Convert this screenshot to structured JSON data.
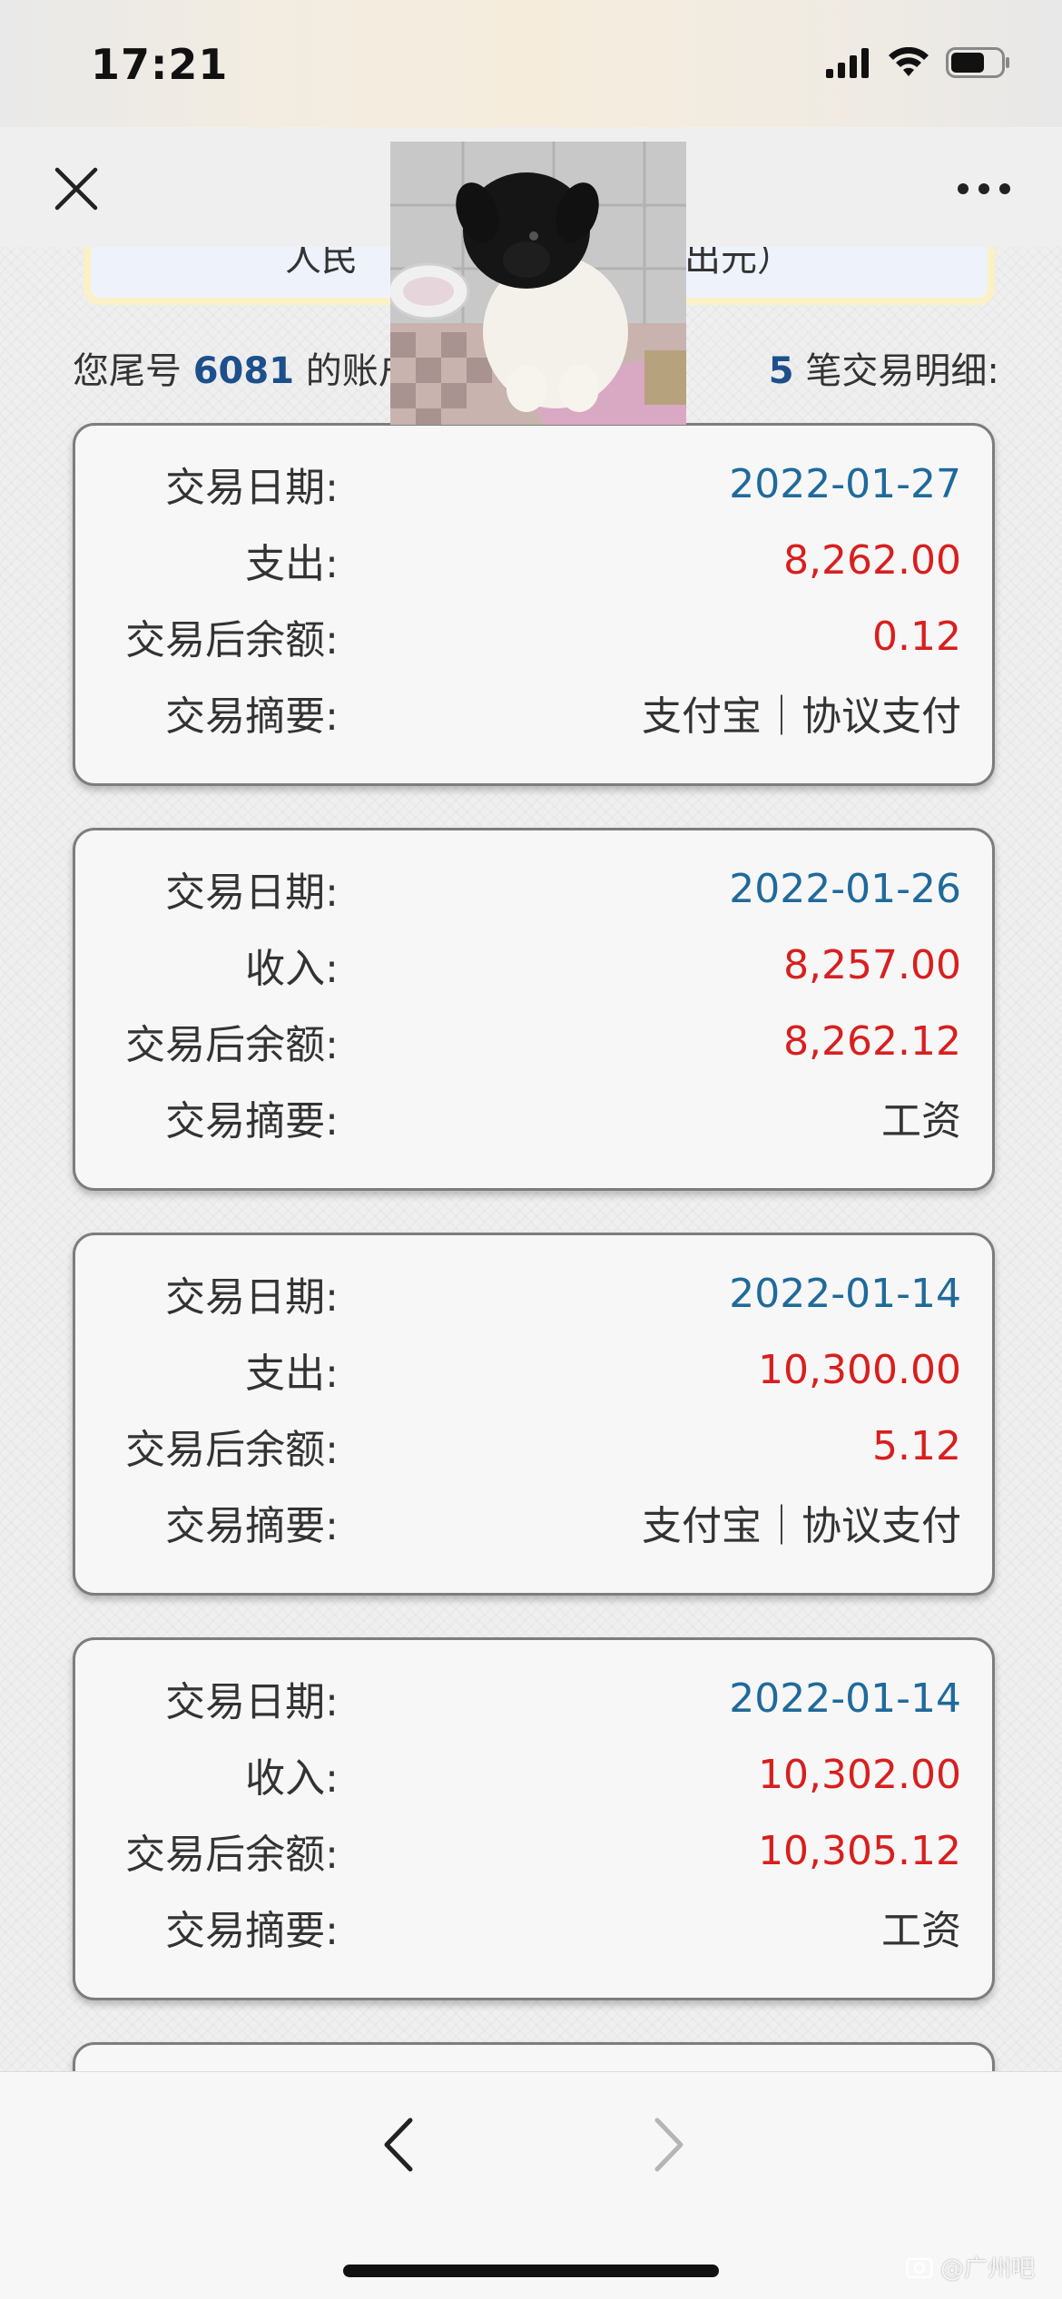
{
  "status_bar": {
    "time": "17:21"
  },
  "nav": {
    "close_icon": "close-icon",
    "more_icon": "more-horizontal-icon"
  },
  "notice": {
    "text_left": "人民",
    "text_right": "出元）"
  },
  "summary": {
    "prefix": "您尾号",
    "account_tail": "6081",
    "middle": "的账户",
    "count": "5",
    "suffix": "笔交易明细:"
  },
  "transactions": [
    {
      "date_label": "交易日期:",
      "date": "2022-01-27",
      "type_label": "支出:",
      "amount": "8,262.00",
      "balance_label": "交易后余额:",
      "balance": "0.12",
      "memo_label": "交易摘要:",
      "memo": "支付宝｜协议支付"
    },
    {
      "date_label": "交易日期:",
      "date": "2022-01-26",
      "type_label": "收入:",
      "amount": "8,257.00",
      "balance_label": "交易后余额:",
      "balance": "8,262.12",
      "memo_label": "交易摘要:",
      "memo": "工资"
    },
    {
      "date_label": "交易日期:",
      "date": "2022-01-14",
      "type_label": "支出:",
      "amount": "10,300.00",
      "balance_label": "交易后余额:",
      "balance": "5.12",
      "memo_label": "交易摘要:",
      "memo": "支付宝｜协议支付"
    },
    {
      "date_label": "交易日期:",
      "date": "2022-01-14",
      "type_label": "收入:",
      "amount": "10,302.00",
      "balance_label": "交易后余额:",
      "balance": "10,305.12",
      "memo_label": "交易摘要:",
      "memo": "工资"
    }
  ],
  "bottom_bar": {
    "back_icon": "chevron-left-icon",
    "forward_icon": "chevron-right-icon"
  },
  "watermark": {
    "text": "@广州吧"
  },
  "colors": {
    "date": "#1f6a9a",
    "amount": "#d81f1f",
    "account_number": "#1d4f8c",
    "card_border": "#7d7d7d"
  }
}
